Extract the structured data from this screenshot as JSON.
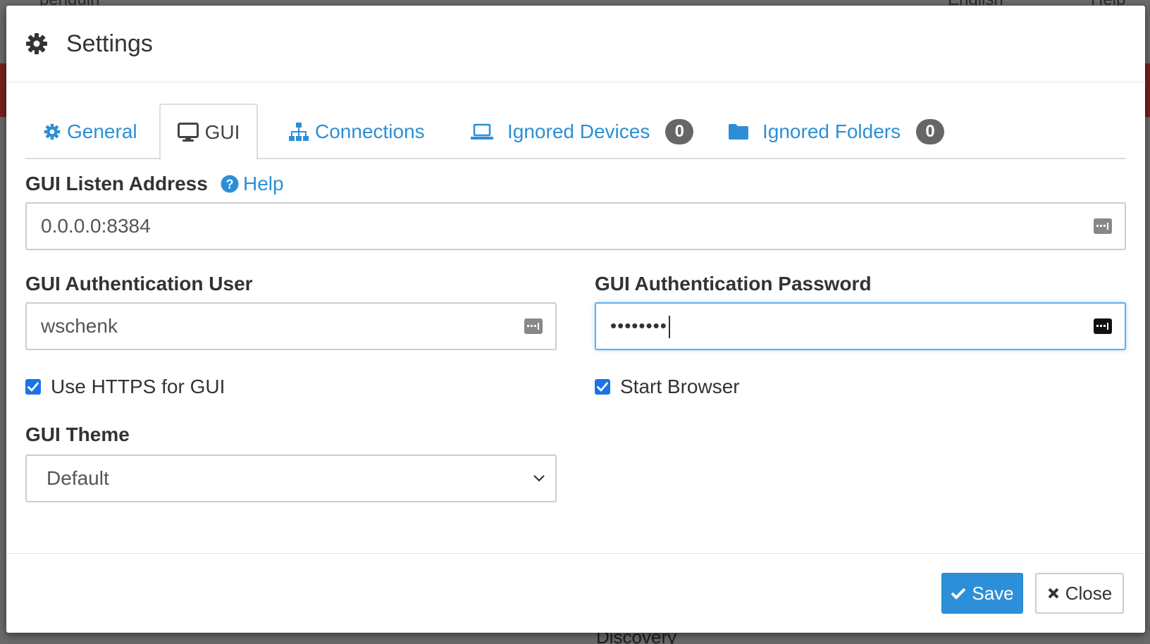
{
  "background": {
    "top_left_text": "penguin",
    "top_right_lang": "English",
    "top_right_help": "Help",
    "bottom_text": "Discovery"
  },
  "modal": {
    "title": "Settings",
    "title_icon": "gear-icon"
  },
  "tabs": [
    {
      "label": "General",
      "icon": "gear-icon",
      "active": false
    },
    {
      "label": "GUI",
      "icon": "desktop-icon",
      "active": true
    },
    {
      "label": "Connections",
      "icon": "sitemap-icon",
      "active": false
    },
    {
      "label": "Ignored Devices",
      "icon": "laptop-icon",
      "active": false,
      "badge": "0"
    },
    {
      "label": "Ignored Folders",
      "icon": "folder-icon",
      "active": false,
      "badge": "0"
    }
  ],
  "form": {
    "listen_address": {
      "label": "GUI Listen Address",
      "help": "Help",
      "value": "0.0.0.0:8384"
    },
    "auth_user": {
      "label": "GUI Authentication User",
      "value": "wschenk"
    },
    "auth_password": {
      "label": "GUI Authentication Password",
      "value": "••••••••"
    },
    "use_https": {
      "label": "Use HTTPS for GUI",
      "checked": true
    },
    "start_browser": {
      "label": "Start Browser",
      "checked": true
    },
    "theme": {
      "label": "GUI Theme",
      "selected": "Default"
    }
  },
  "footer": {
    "save_label": "Save",
    "close_label": "Close"
  },
  "colors": {
    "accent": "#2c8fd6",
    "save_button": "#2d8fd8",
    "badge": "#666666",
    "checkbox": "#1a73e8"
  }
}
